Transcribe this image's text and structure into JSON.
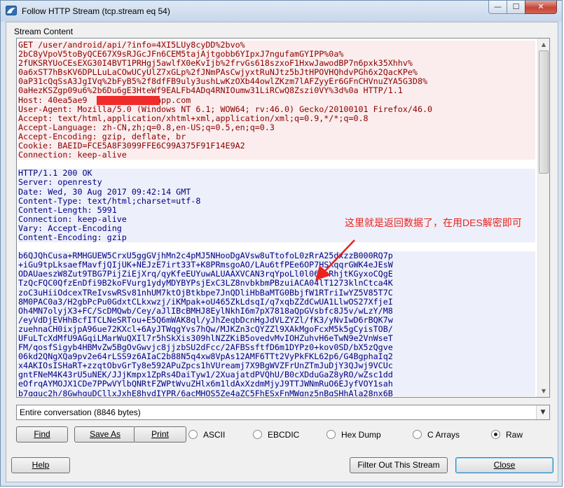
{
  "window": {
    "title": "Follow HTTP Stream (tcp.stream eq 54)",
    "controls": {
      "minimize": "—",
      "maximize": "☐",
      "close": "✕"
    }
  },
  "stream": {
    "group_label": "Stream Content",
    "request_lines": [
      "GET /user/android/api/?info=4XI5LUy8cyDD%2bvo%",
      "2bC8yVpoV5toByQCE67X9sRJGcJFn6CEM5tajAjtgobb6YIpxJ7ngufamGYIPP%0a%",
      "2fUKSRYUoCEsEXG30I4BVT1PRHgj5awlfX0eKvIjb%2frvGs618szxoF1HxwJawodBP7n6pxk35Xhhv%",
      "0a6xST7hBsKV6DPLLuLaCOwUCyUlZ7xGLp%2fJNmPAsCwjyxtRuNJtz5bJtHPOVHQhdvPGh6x2QacKPe%",
      "0aP31cQqSsA3JgIVq%2bFyB5%2f8dfFB9uly3ushLwKzOXb44owlZKzm7lAFZyyEr6GFnCHVnuZYA5G3D8%",
      "0aHezKSZgp09u6%2b6Du6gE3HteWf9EALFb4ADq4RNIOumw31LiRCwQ8Zszi0VY%3d%0a HTTP/1.1",
      "Host: 40ea5ae9              app.com",
      "User-Agent: Mozilla/5.0 (Windows NT 6.1; WOW64; rv:46.0) Gecko/20100101 Firefox/46.0",
      "Accept: text/html,application/xhtml+xml,application/xml;q=0.9,*/*;q=0.8",
      "Accept-Language: zh-CN,zh;q=0.8,en-US;q=0.5,en;q=0.3",
      "Accept-Encoding: gzip, deflate, br",
      "Cookie: BAEID=FCE5A8F3099FFE6C99A375F91F14E9A2",
      "Connection: keep-alive"
    ],
    "response_header_lines": [
      "HTTP/1.1 200 OK",
      "Server: openresty",
      "Date: Wed, 30 Aug 2017 09:42:14 GMT",
      "Content-Type: text/html;charset=utf-8",
      "Content-Length: 5991",
      "Connection: keep-alive",
      "Vary: Accept-Encoding",
      "Content-Encoding: gzip"
    ],
    "response_body_lines": [
      "b6QJQhCusa+RMHGUEW5CrxU5ggGVjhMn2c4pMJ5NHooDgAVsw8uTtofoL0zRrA25dxzzB000RQ7p",
      "+iGu9tpLksaefMavfjQIjUK+NEJzE7irt33T+K8PRmsgoAO/LAu6tfPEe6OP7HSXqqrGWK4eJEsW",
      "ODAUaeszW8Zut9TBG7PijZiEjXrq/qyKfeEUYuwALUAAXVCAN3rqYpoLl0l06+uRhjtKGyxoCQgE",
      "TzQcFQC0QfzEnDfi9B2koFVurg1ydyMDYBYPsjExC3LZ8nvbkbmPBzuiACA04lT1273klnCtca4K",
      "zoC3uHiiOdcexTReIvswRSv81nhUM7ktOjBtkbpe7JnQDliHbBaMTG0BbjfW1RTriIwYZ5V85T7C",
      "8M0PAC0a3/H2gbPcPu0GdxtCLkxwzj/iKMpak+oU465ZkLdsqI/q7xqbZZdCwUA1LlwOS27XfjeI",
      "Oh4MN7olyjX3+FC/ScDMQwb/Cey/aJlIBcBMHJ8EylNkhI6m7pX7818aQpGVsbfc8J5v/wLzY/M8",
      "/eyVdDjEVHhBcfITCLNeSRTou+E5Q6mWAK8ql/yJhZeqbDcnHgJdVLZYZl/fK3/yNvIwD6rBQK7w",
      "zuehnaCH0ixjpA96ue72KXcl+6AyJTWqgYvs7hQw/MJKZn3cQYZZl9XAkMgoFcxM5k5gCyisTOB/",
      "UFuLTcXdMfU9AGqiLMarWuQXIl7r5hSkXis309hlNZZKiB5ovedvMvIOHZuhvH6eTwN9e2VnWseT",
      "FM/qosfSigyb4HBMvZw5BgOvGwvjc8jjzbSU2dFcc/2AFBSsftfD6m1DYPz0+kov0SD/bX5zQgve",
      "06kd2QNgXQa9pv2e64rLSS9z6AIaC2b88N5q4xw8VpAs12AMF6TTt2VyPkFKL62p6/G4BgphaIq2",
      "x4AKIOsISHaRT+zzqtObvGrTy8e592APuZpcs1hVUreamj7X9BgWVZFrUnZTmJuDjY3QJwj9VCUc",
      "gntFNeM4K43rU5uNEK/JJjKmpx1ZpRs4DaiTyw1/2XuajatdPVQhU/B0cXDduGaZ8yRO/wZsc1dd",
      "eOfrqAYMOJX1CDe7PPwVYlbQNRtFZWPtWvuZHlx6m1ldAxXzdmMjyJ9TTJWNmRuO6EJyfVOY1sah",
      "b7qguc2h/8GwhquDCllxJxhE8hvdIYPR/6acMHQS5Ze4aZC5FhESxFnMWgnz5nBqSHhAla28nx6B"
    ],
    "annotation": "这里就是返回数据了，在用DES解密即可"
  },
  "controls": {
    "show_selector": "Entire conversation (8846 bytes)",
    "find_label": "Find",
    "save_as_label": "Save As",
    "print_label": "Print",
    "formats": [
      {
        "label": "ASCII",
        "selected": false
      },
      {
        "label": "EBCDIC",
        "selected": false
      },
      {
        "label": "Hex Dump",
        "selected": false
      },
      {
        "label": "C Arrays",
        "selected": false
      },
      {
        "label": "Raw",
        "selected": true
      }
    ],
    "help_label": "Help",
    "filter_out_label": "Filter Out This Stream",
    "close_label": "Close"
  },
  "colors": {
    "client_text": "#8b0000",
    "client_bg": "#fbeded",
    "server_text": "#00007f",
    "server_bg": "#edf0fb",
    "annotation": "#e8231e",
    "redaction": "#ef2b2b"
  }
}
